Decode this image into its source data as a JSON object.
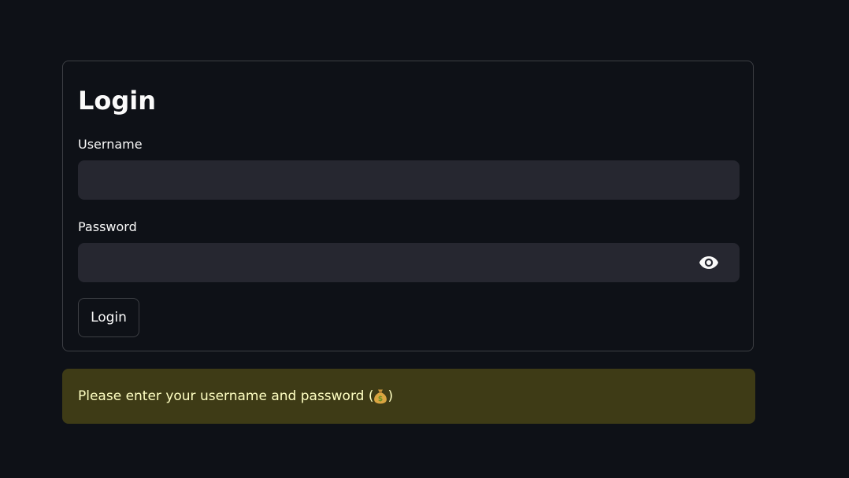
{
  "login_form": {
    "title": "Login",
    "username_label": "Username",
    "username_value": "",
    "password_label": "Password",
    "password_value": "",
    "password_toggle_icon": "eye-icon",
    "submit_label": "Login"
  },
  "alert": {
    "text_before": "Please enter your username and password (",
    "emoji_icon": "money-bag-icon",
    "text_after": ")",
    "colors": {
      "background": "#3e3b16",
      "text": "#ffffc2"
    }
  },
  "theme": {
    "background": "#0e1117",
    "input_background": "#262730",
    "text": "#fafafa"
  }
}
